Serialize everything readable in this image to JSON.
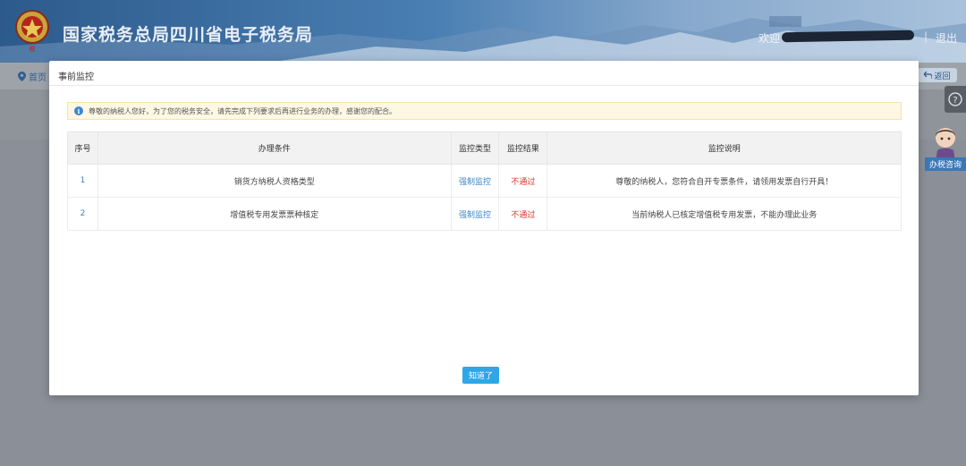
{
  "header": {
    "site_title": "国家税务总局四川省电子税务局",
    "welcome": "欢迎",
    "separator": "|",
    "logout": "退出"
  },
  "nav": {
    "home": "首页",
    "back": "返回",
    "consult": "办税咨询"
  },
  "modal": {
    "title": "事前监控",
    "notice": "尊敬的纳税人您好，为了您的税务安全，请先完成下列要求后再进行业务的办理，感谢您的配合。",
    "columns": [
      "序号",
      "办理条件",
      "监控类型",
      "监控结果",
      "监控说明"
    ],
    "rows": [
      {
        "index": "1",
        "condition": "销货方纳税人资格类型",
        "type": "强制监控",
        "result": "不通过",
        "description": "尊敬的纳税人，您符合自开专票条件，请领用发票自行开具！"
      },
      {
        "index": "2",
        "condition": "增值税专用发票票种核定",
        "type": "强制监控",
        "result": "不通过",
        "description": "当前纳税人已核定增值税专用发票，不能办理此业务"
      }
    ],
    "ok_button": "知道了"
  },
  "colors": {
    "accent": "#2fa7e6",
    "link": "#3a86c8",
    "fail": "#d9342b",
    "notice_bg": "#fdf7e3"
  }
}
